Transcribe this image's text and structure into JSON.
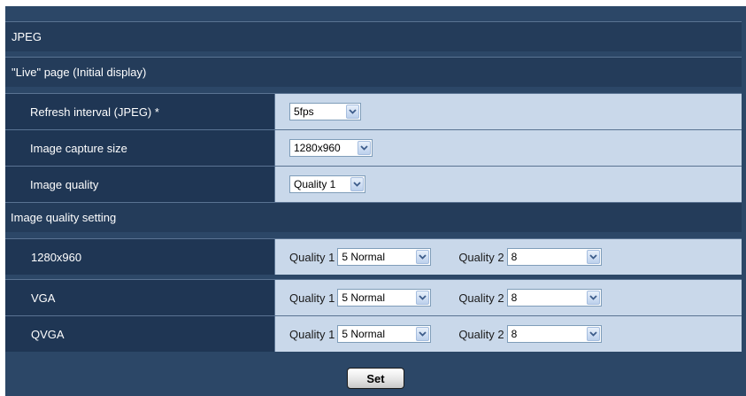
{
  "sections": {
    "jpeg_title": "JPEG",
    "live_page_title": "\"Live\" page (Initial display)",
    "quality_setting_title": "Image quality setting"
  },
  "live": {
    "refresh_label": "Refresh interval (JPEG) *",
    "refresh_value": "5fps",
    "capture_label": "Image capture size",
    "capture_value": "1280x960",
    "quality_label": "Image quality",
    "quality_value": "Quality 1"
  },
  "quality_rows": [
    {
      "label": "1280x960",
      "q1_label": "Quality 1",
      "q1_value": "5 Normal",
      "q2_label": "Quality 2",
      "q2_value": "8"
    },
    {
      "label": "VGA",
      "q1_label": "Quality 1",
      "q1_value": "5 Normal",
      "q2_label": "Quality 2",
      "q2_value": "8"
    },
    {
      "label": "QVGA",
      "q1_label": "Quality 1",
      "q1_value": "5 Normal",
      "q2_label": "Quality 2",
      "q2_value": "8"
    }
  ],
  "buttons": {
    "set_label": "Set"
  },
  "icons": {
    "dropdown": "chevron-down-icon"
  },
  "colors": {
    "panel_bg": "#2c4767",
    "header_bg": "#243c5a",
    "label_bg": "#1f3654",
    "value_bg": "#c9d8ea"
  }
}
